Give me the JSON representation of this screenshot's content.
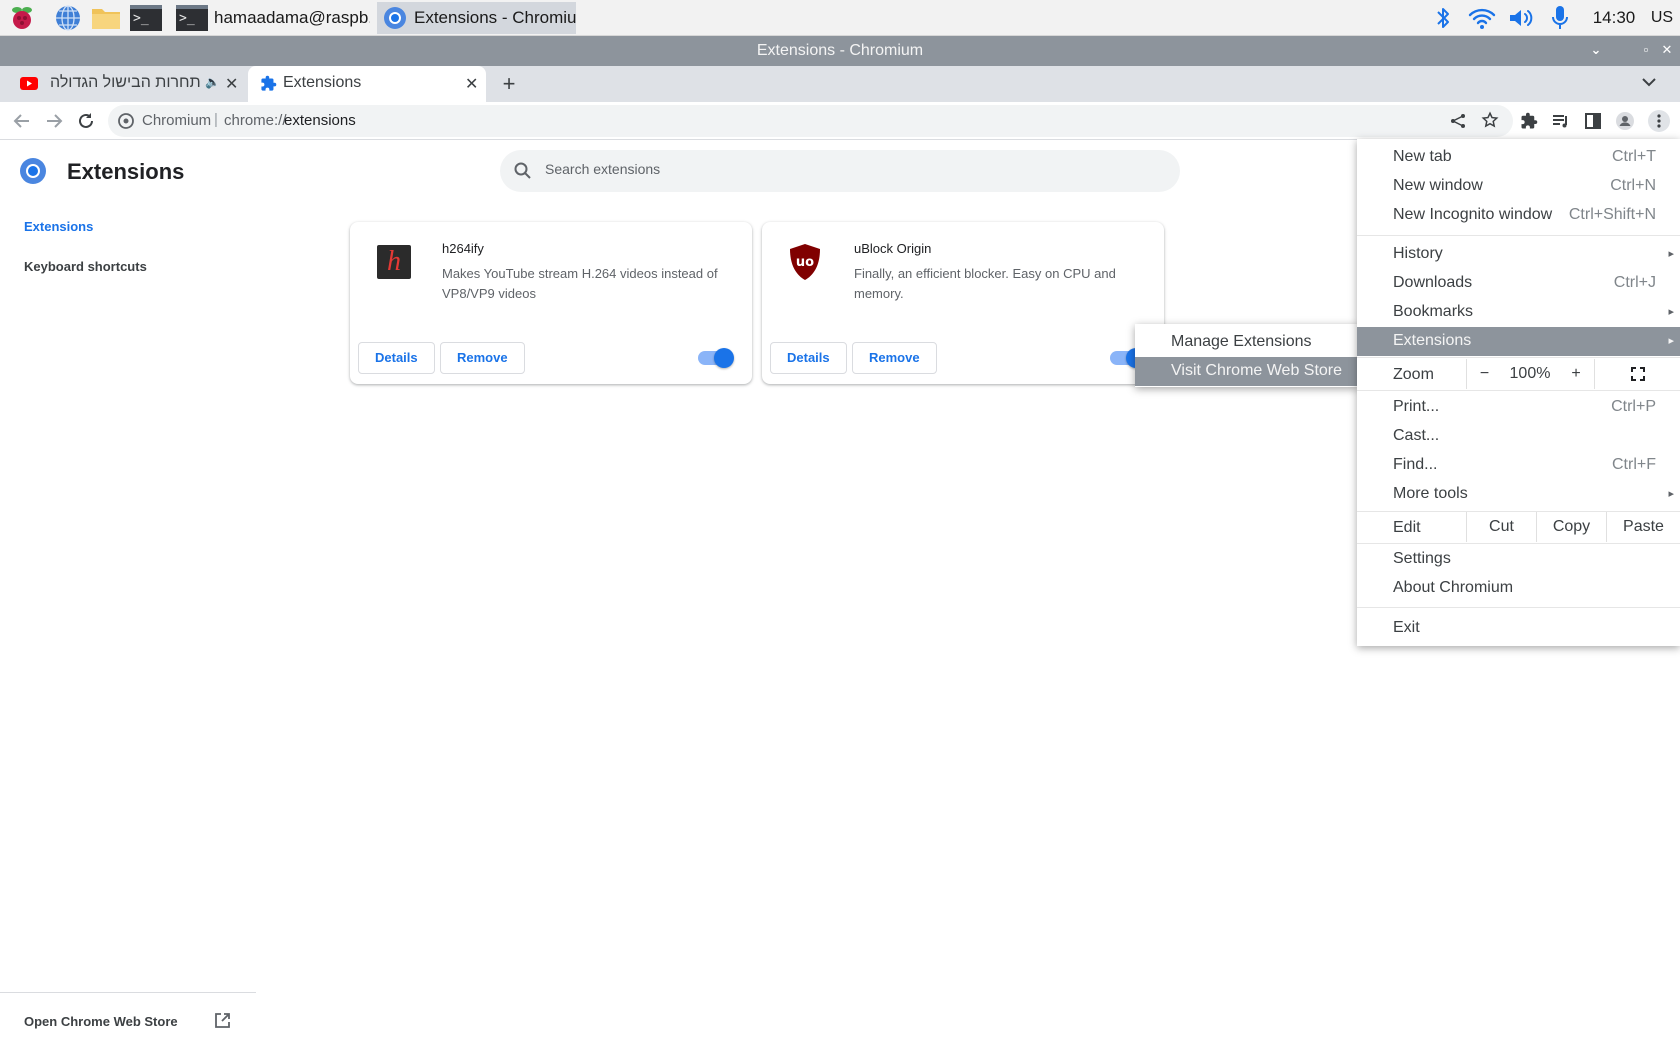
{
  "taskbar": {
    "task_terminal": "hamaadama@raspb...",
    "task_chromium": "Extensions - Chromiu...",
    "clock": "14:30",
    "keyboard_layout": "US"
  },
  "window": {
    "title": "Extensions - Chromium"
  },
  "tabs": [
    {
      "label": "תחרות הבישול הגדולה"
    },
    {
      "label": "Extensions"
    }
  ],
  "omnibox": {
    "site_label": "Chromium",
    "separator": "|",
    "scheme": "chrome://",
    "path": "extensions"
  },
  "page": {
    "title": "Extensions",
    "search_placeholder": "Search extensions",
    "nav": {
      "extensions": "Extensions",
      "keyboard_shortcuts": "Keyboard shortcuts"
    },
    "open_store": "Open Chrome Web Store"
  },
  "extensions": [
    {
      "name": "h264ify",
      "description": "Makes YouTube stream H.264 videos instead of VP8/VP9 videos",
      "details_label": "Details",
      "remove_label": "Remove",
      "enabled": true
    },
    {
      "name": "uBlock Origin",
      "description": "Finally, an efficient blocker. Easy on CPU and memory.",
      "details_label": "Details",
      "remove_label": "Remove",
      "enabled": true
    }
  ],
  "menu": {
    "new_tab": {
      "label": "New tab",
      "shortcut": "Ctrl+T"
    },
    "new_window": {
      "label": "New window",
      "shortcut": "Ctrl+N"
    },
    "new_incognito": {
      "label": "New Incognito window",
      "shortcut": "Ctrl+Shift+N"
    },
    "history": {
      "label": "History"
    },
    "downloads": {
      "label": "Downloads",
      "shortcut": "Ctrl+J"
    },
    "bookmarks": {
      "label": "Bookmarks"
    },
    "extensions": {
      "label": "Extensions"
    },
    "zoom": {
      "label": "Zoom",
      "minus": "−",
      "value": "100%",
      "plus": "+"
    },
    "print": {
      "label": "Print...",
      "shortcut": "Ctrl+P"
    },
    "cast": {
      "label": "Cast..."
    },
    "find": {
      "label": "Find...",
      "shortcut": "Ctrl+F"
    },
    "more_tools": {
      "label": "More tools"
    },
    "edit": {
      "label": "Edit",
      "cut": "Cut",
      "copy": "Copy",
      "paste": "Paste"
    },
    "settings": {
      "label": "Settings"
    },
    "about": {
      "label": "About Chromium"
    },
    "exit": {
      "label": "Exit"
    }
  },
  "submenu": {
    "manage": "Manage Extensions",
    "visit_store": "Visit Chrome Web Store"
  },
  "colors": {
    "accent_blue": "#1a73e8",
    "menu_highlight": "#8d949c",
    "titlebar": "#8d949c",
    "tabstrip": "#dee1e6"
  }
}
